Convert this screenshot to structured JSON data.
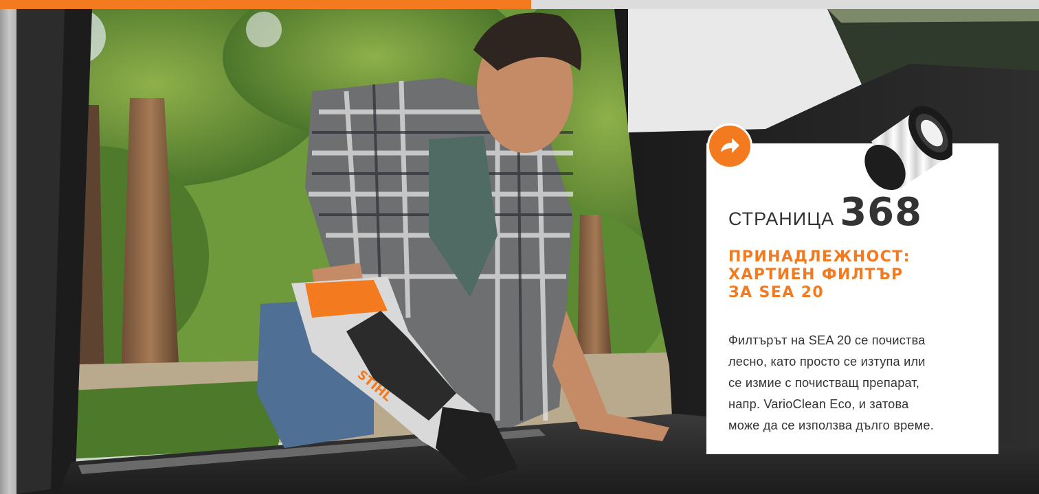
{
  "colors": {
    "accent": "#f37a1f",
    "text_dark": "#333333",
    "card_background": "#ffffff"
  },
  "photo": {
    "description_icon": "handheld-vacuum-photo",
    "brand_mark": "STIHL"
  },
  "badge": {
    "icon": "arrow-right-icon"
  },
  "card": {
    "page_label": "СТРАНИЦА",
    "page_number": "368",
    "heading_lines": [
      "ПРИНАДЛЕЖНОСТ:",
      "ХАРТИЕН ФИЛТЪР",
      "ЗА SEA 20"
    ],
    "body_lines": [
      "Филтърът на SEA 20 се почиства",
      "лесно, като просто се изтупа или",
      "се измие с почистващ препарат,",
      "напр. VarioClean Eco, и затова",
      "може да се използва дълго време."
    ]
  }
}
